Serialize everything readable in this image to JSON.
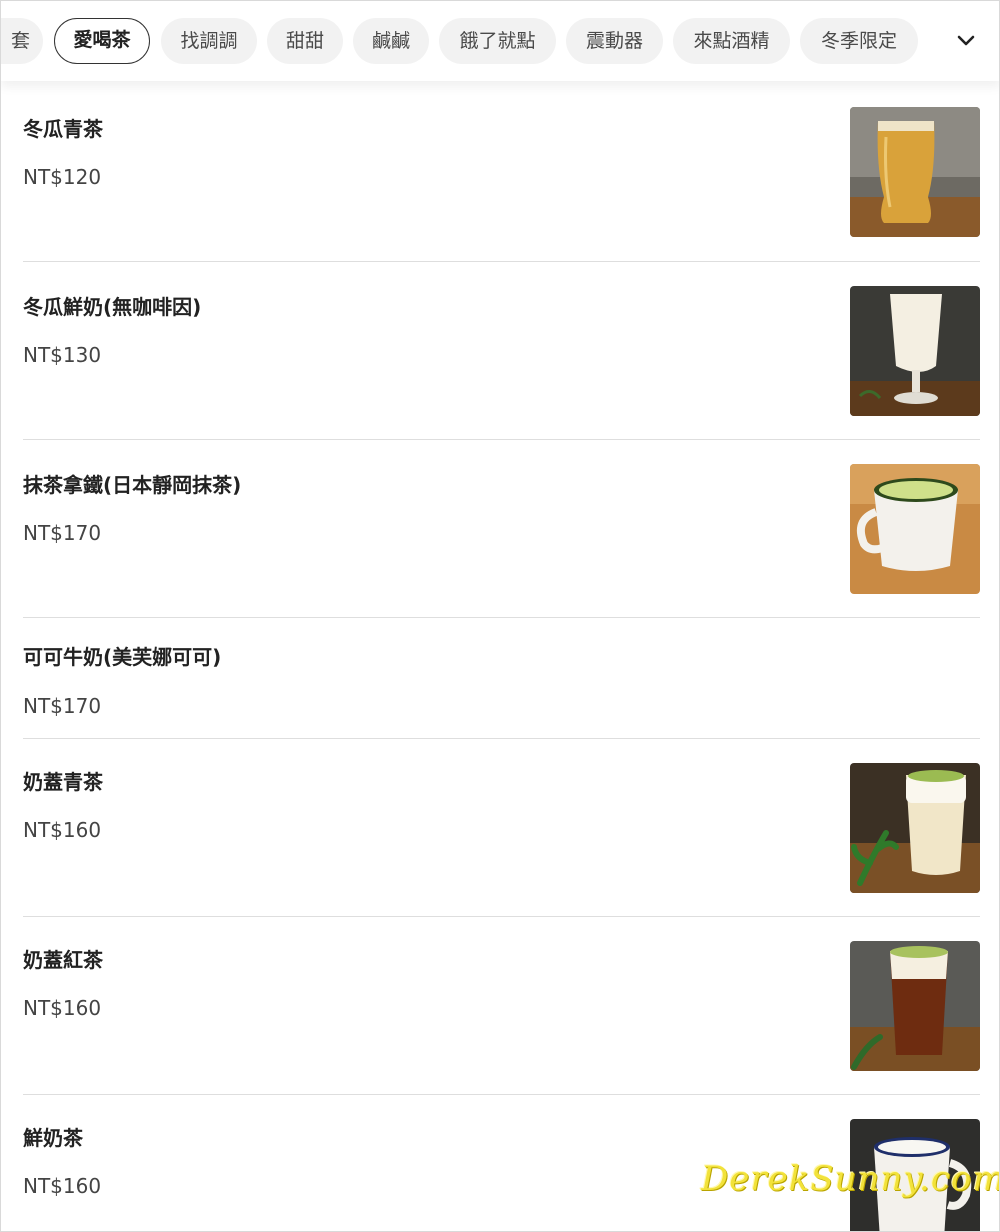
{
  "categories": {
    "partial_label": "套",
    "items": [
      "愛喝茶",
      "找調調",
      "甜甜",
      "鹹鹹",
      "餓了就點",
      "震動器",
      "來點酒精",
      "冬季限定"
    ],
    "active": "愛喝茶",
    "expand_icon": "chevron-down-icon"
  },
  "menu": [
    {
      "name": "冬瓜青茶",
      "price": "NT$120",
      "image": "iced-green-tea-glass"
    },
    {
      "name": "冬瓜鮮奶(無咖啡因)",
      "price": "NT$130",
      "image": "milk-parfait-glass"
    },
    {
      "name": "抹茶拿鐵(日本靜岡抹茶)",
      "price": "NT$170",
      "image": "matcha-latte-mug"
    },
    {
      "name": "可可牛奶(美芙娜可可)",
      "price": "NT$170"
    },
    {
      "name": "奶蓋青茶",
      "price": "NT$160",
      "image": "cheese-foam-green-tea"
    },
    {
      "name": "奶蓋紅茶",
      "price": "NT$160",
      "image": "cheese-foam-black-tea"
    },
    {
      "name": "鮮奶茶",
      "price": "NT$160",
      "image": "milk-tea-mug"
    }
  ],
  "watermark": "DerekSunny.com",
  "colors": {
    "active_border": "#333333",
    "pill_bg": "#f2f2f2",
    "divider": "#dedede",
    "watermark": "#f2e23a"
  }
}
